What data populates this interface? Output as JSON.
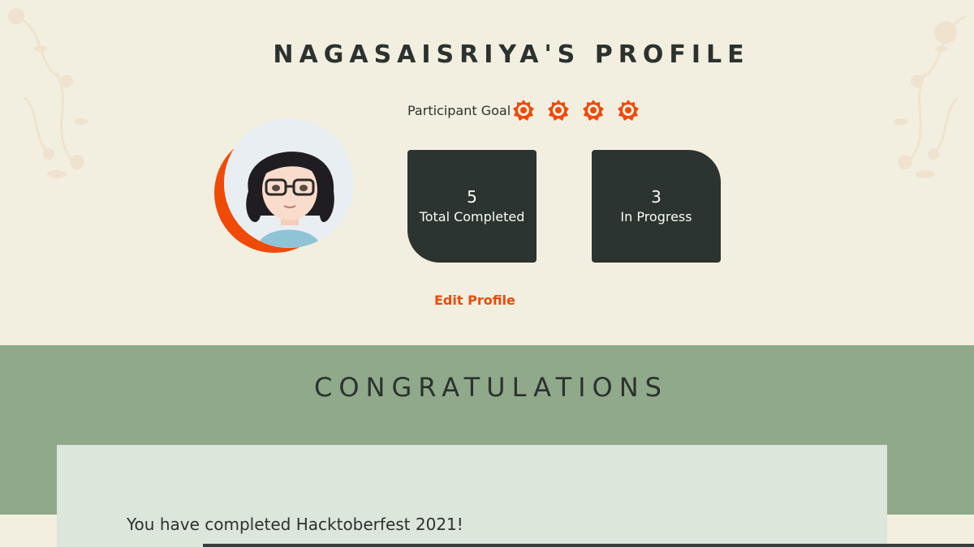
{
  "profile": {
    "title": "NAGASAISRIYA'S PROFILE",
    "goal_label": "Participant Goal",
    "badges": [
      "gear-badge-icon",
      "gear-badge-icon",
      "gear-badge-icon",
      "gear-badge-icon"
    ],
    "stats": {
      "completed": {
        "value": "5",
        "label": "Total Completed"
      },
      "in_progress": {
        "value": "3",
        "label": "In Progress"
      }
    },
    "edit_label": "Edit Profile"
  },
  "congrats": {
    "title": "CONGRATULATIONS",
    "message": "You have completed Hacktoberfest 2021!"
  },
  "colors": {
    "page_bg": "#f3efe0",
    "dark": "#2b3430",
    "accent": "#ea4b09",
    "band": "#90a98b",
    "card": "#dce6da"
  }
}
